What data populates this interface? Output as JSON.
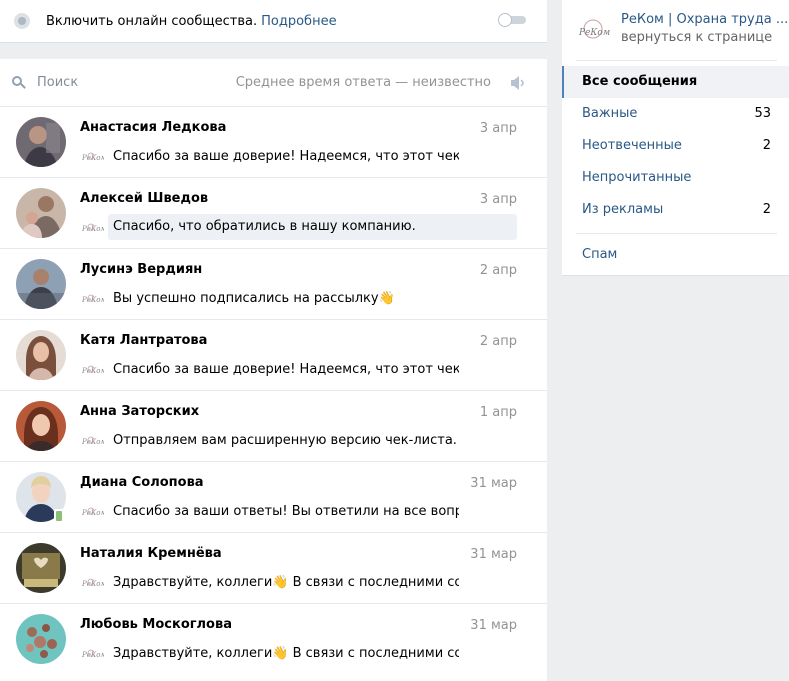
{
  "toggle_bar": {
    "text": "Включить онлайн сообщества.",
    "link": "Подробнее"
  },
  "search": {
    "placeholder": "Поиск",
    "response_time": "Среднее время ответа — неизвестно"
  },
  "icons": {
    "search": "search-icon",
    "sound": "speaker-icon",
    "radio": "radio-icon",
    "switch": "toggle-switch-icon"
  },
  "colors": {
    "link": "#2a5885",
    "background": "#edeef0",
    "online": "#8ac176",
    "active_border": "#5181b8"
  },
  "dialogs": [
    {
      "name": "Анастасия Ледкова",
      "date": "3 апр",
      "preview": "Спасибо за ваше доверие! Надеемся, что этот чек-л...",
      "online": false,
      "unread": false
    },
    {
      "name": "Алексей Шведов",
      "date": "3 апр",
      "preview": "Спасибо, что обратились в нашу компанию.",
      "online": false,
      "unread": true
    },
    {
      "name": "Лусинэ Вердиян",
      "date": "2 апр",
      "preview": "Вы успешно подписались на рассылку",
      "emoji_after": "👋",
      "online": false,
      "unread": false
    },
    {
      "name": "Катя Лантратова",
      "date": "2 апр",
      "preview": "Спасибо за ваше доверие! Надеемся, что этот чек-л...",
      "online": false,
      "unread": false
    },
    {
      "name": "Анна Заторских",
      "date": "1 апр",
      "preview": "Отправляем вам расширенную версию чек-листа. С ...",
      "online": false,
      "unread": false
    },
    {
      "name": "Диана Солопова",
      "date": "31 мар",
      "preview": "Спасибо за ваши ответы! Вы ответили на все вопрос...",
      "online": true,
      "unread": false
    },
    {
      "name": "Наталия Кремнёва",
      "date": "31 мар",
      "preview_before": "Здравствуйте, коллеги",
      "emoji": "👋",
      "preview_after": " В связи с последними соб...",
      "online": false,
      "unread": false
    },
    {
      "name": "Любовь Москоглова",
      "date": "31 мар",
      "preview_before": "Здравствуйте, коллеги",
      "emoji": "👋",
      "preview_after": " В связи с последними соб...",
      "online": false,
      "unread": false
    }
  ],
  "group": {
    "name": "РеКом | Охрана труда ...",
    "back": "вернуться к странице",
    "logo_text": "РеКом"
  },
  "nav": [
    {
      "label": "Все сообщения",
      "count": "",
      "active": true
    },
    {
      "label": "Важные",
      "count": "53",
      "active": false
    },
    {
      "label": "Неотвеченные",
      "count": "2",
      "active": false
    },
    {
      "label": "Непрочитанные",
      "count": "",
      "active": false
    },
    {
      "label": "Из рекламы",
      "count": "2",
      "active": false
    }
  ],
  "nav_spam": {
    "label": "Спам"
  }
}
